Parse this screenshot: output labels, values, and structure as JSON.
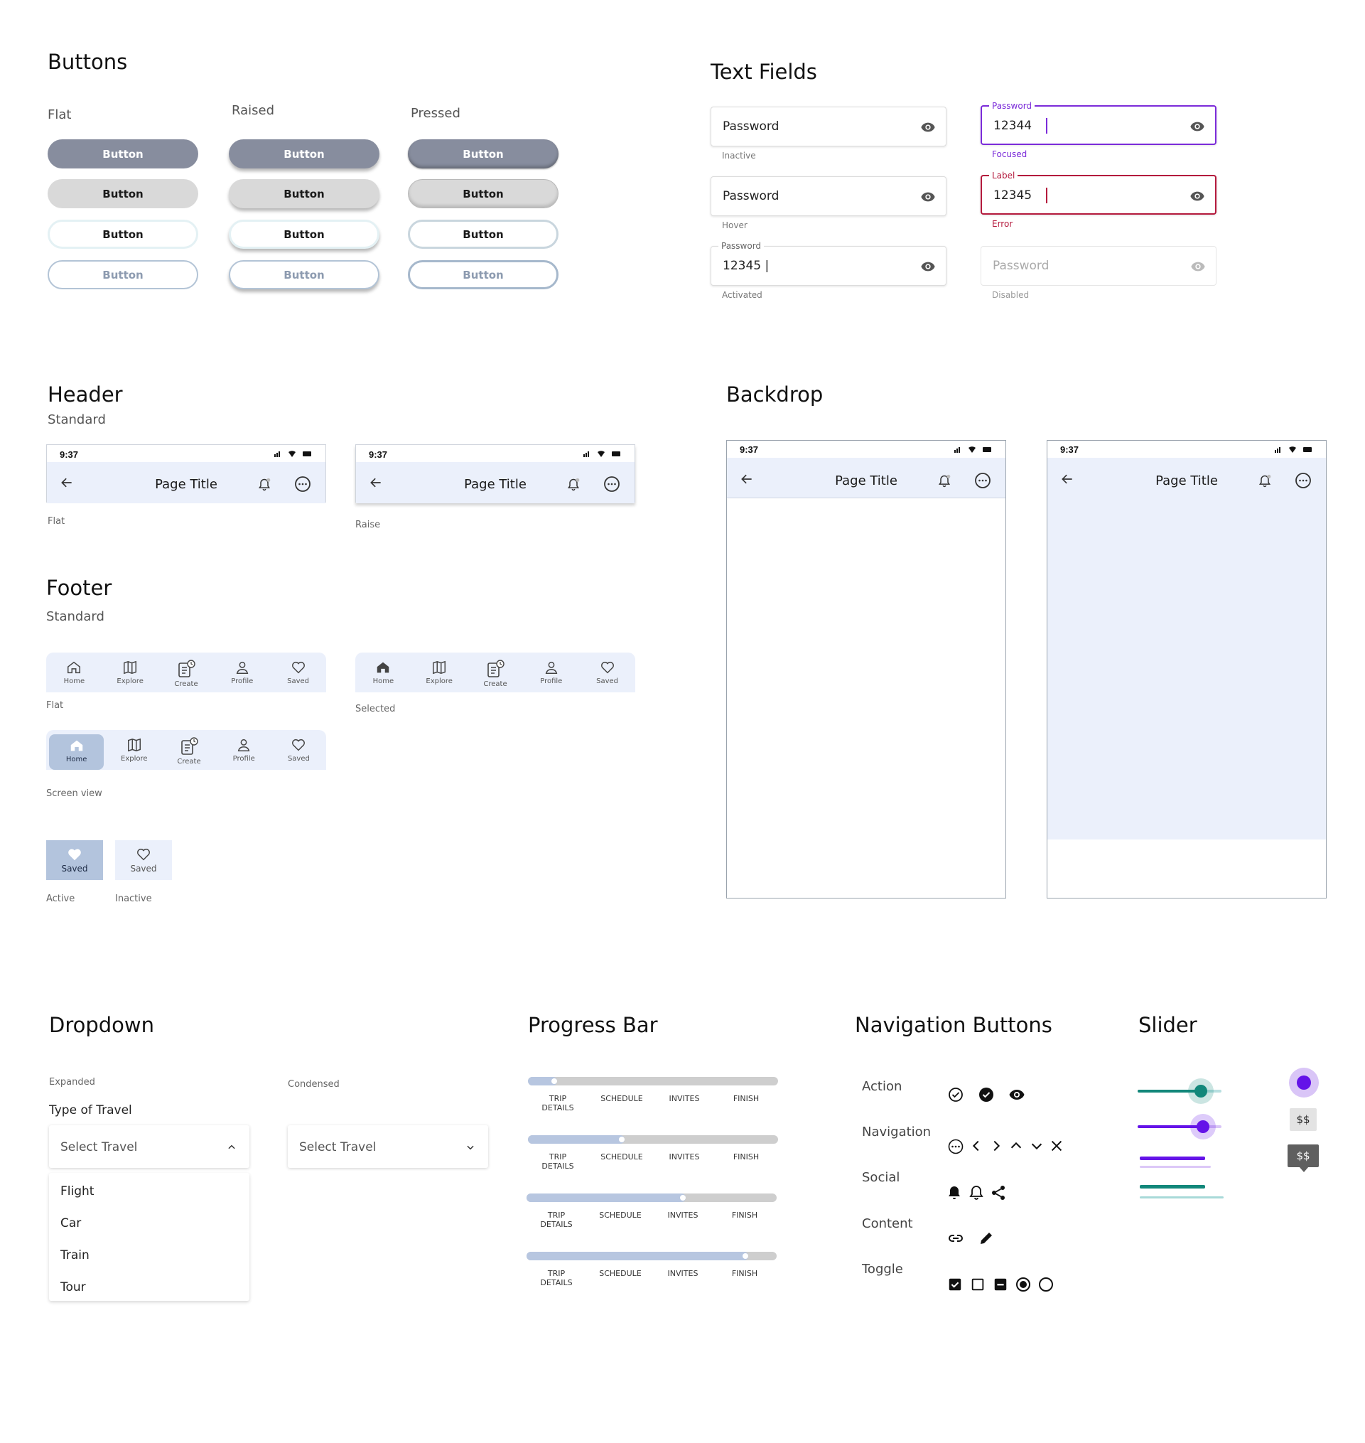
{
  "buttons": {
    "title": "Buttons",
    "col_flat": "Flat",
    "col_raised": "Raised",
    "col_pressed": "Pressed",
    "label": "Button"
  },
  "text_fields": {
    "title": "Text Fields",
    "placeholder": "Password",
    "inactive_caption": "Inactive",
    "hover_caption": "Hover",
    "activated_label": "Password",
    "activated_value": "12345 |",
    "activated_caption": "Activated",
    "focused_label": "Password",
    "focused_value": "12344",
    "focused_caption": "Focused",
    "error_label": "Label",
    "error_value": "12345",
    "error_caption": "Error",
    "disabled_placeholder": "Password",
    "disabled_caption": "Disabled",
    "colors": {
      "focus": "#7b2bd9",
      "error": "#b41a3d"
    }
  },
  "header": {
    "title": "Header",
    "subtitle": "Standard",
    "time": "9:37",
    "page_title": "Page Title",
    "flat_caption": "Flat",
    "raise_caption": "Raise"
  },
  "backdrop": {
    "title": "Backdrop",
    "time": "9:37",
    "page_title": "Page Title"
  },
  "footer": {
    "title": "Footer",
    "subtitle": "Standard",
    "items": [
      "Home",
      "Explore",
      "Create",
      "Profile",
      "Saved"
    ],
    "flat_caption": "Flat",
    "selected_caption": "Selected",
    "screen_view_caption": "Screen view",
    "saved_label": "Saved",
    "active_caption": "Active",
    "inactive_caption": "Inactive"
  },
  "dropdown": {
    "title": "Dropdown",
    "expanded_caption": "Expanded",
    "condensed_caption": "Condensed",
    "field_label": "Type of Travel",
    "placeholder": "Select Travel",
    "options": [
      "Flight",
      "Car",
      "Train",
      "Tour"
    ]
  },
  "progress": {
    "title": "Progress Bar",
    "steps": [
      "TRIP\nDETAILS",
      "SCHEDULE",
      "INVITES",
      "FINISH"
    ],
    "step_trip": "TRIP",
    "step_details": "DETAILS",
    "levels": [
      0.1,
      0.37,
      0.62,
      0.87
    ]
  },
  "navigation": {
    "title": "Navigation Buttons",
    "rows": [
      "Action",
      "Navigation",
      "Social",
      "Content",
      "Toggle"
    ]
  },
  "slider": {
    "title": "Slider",
    "value_label": "$$",
    "colors": {
      "teal": "#12877a",
      "purple": "#6413e8"
    },
    "levels": [
      0.75,
      0.78
    ]
  }
}
